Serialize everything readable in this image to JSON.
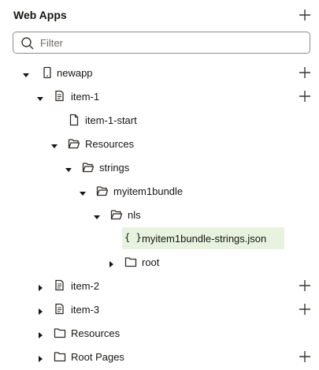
{
  "header": {
    "title": "Web Apps",
    "add_icon": "plus-icon"
  },
  "filter": {
    "placeholder": "Filter",
    "value": ""
  },
  "tree": [
    {
      "id": "newapp",
      "label": "newapp",
      "icon": "mobile-device-icon",
      "expanded": true,
      "has_add": true
    },
    {
      "id": "item-1",
      "label": "item-1",
      "icon": "document-stack-icon",
      "expanded": true,
      "has_add": true
    },
    {
      "id": "item-1-start",
      "label": "item-1-start",
      "icon": "file-icon",
      "leaf": true
    },
    {
      "id": "resources-1",
      "label": "Resources",
      "icon": "folder-open-icon",
      "expanded": true
    },
    {
      "id": "strings",
      "label": "strings",
      "icon": "folder-open-icon",
      "expanded": true
    },
    {
      "id": "myitem1bundle",
      "label": "myitem1bundle",
      "icon": "folder-open-icon",
      "expanded": true
    },
    {
      "id": "nls",
      "label": "nls",
      "icon": "folder-open-icon",
      "expanded": true
    },
    {
      "id": "bundle-json",
      "label": "myitem1bundle-strings.json",
      "icon": "json-braces-icon",
      "glyph": "{ }",
      "leaf": true,
      "selected": true
    },
    {
      "id": "root",
      "label": "root",
      "icon": "folder-icon",
      "expanded": false
    },
    {
      "id": "item-2",
      "label": "item-2",
      "icon": "document-stack-icon",
      "expanded": false,
      "has_add": true
    },
    {
      "id": "item-3",
      "label": "item-3",
      "icon": "document-stack-icon",
      "expanded": false,
      "has_add": true
    },
    {
      "id": "resources-2",
      "label": "Resources",
      "icon": "folder-icon",
      "expanded": false
    },
    {
      "id": "root-pages",
      "label": "Root Pages",
      "icon": "folder-icon",
      "expanded": false,
      "has_add": true
    }
  ],
  "colors": {
    "selected_bg": "#e7f3df",
    "text": "#161513",
    "border": "#8f8b87"
  }
}
